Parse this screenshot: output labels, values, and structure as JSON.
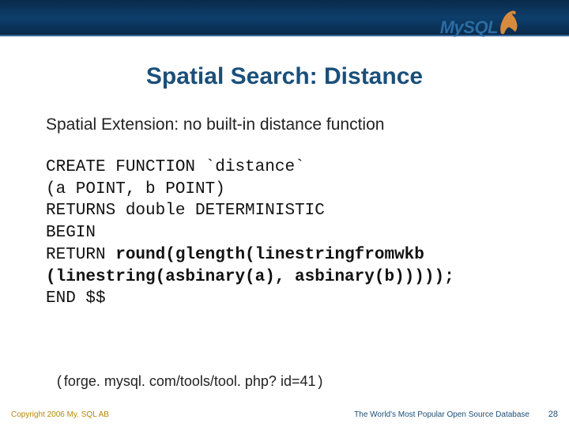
{
  "logo": {
    "text": "MySQL"
  },
  "title": "Spatial Search: Distance",
  "subtitle": "Spatial Extension: no built-in distance function",
  "code": {
    "l1": "CREATE FUNCTION `distance`",
    "l2": "(a POINT, b POINT)",
    "l3": "RETURNS double DETERMINISTIC",
    "l4": "BEGIN",
    "l5a": "RETURN ",
    "l5b": "round(glength(linestringfromwkb",
    "l6": "(linestring(asbinary(a), asbinary(b)))));",
    "l7": "END $$"
  },
  "url": {
    "open": "(",
    "text": "forge. mysql. com/tools/tool. php? id=41",
    "close": ")"
  },
  "footer": {
    "left": "Copyright 2006 My. SQL AB",
    "right": "The World's Most Popular Open Source Database",
    "page": "28"
  }
}
